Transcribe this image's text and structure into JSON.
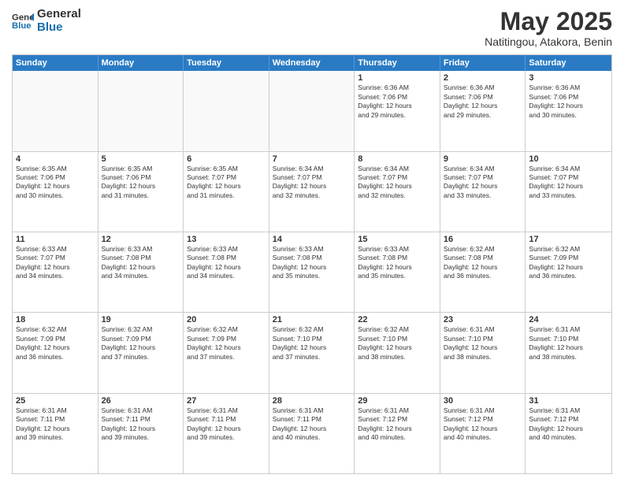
{
  "header": {
    "logo_general": "General",
    "logo_blue": "Blue",
    "title": "May 2025",
    "location": "Natitingou, Atakora, Benin"
  },
  "weekdays": [
    "Sunday",
    "Monday",
    "Tuesday",
    "Wednesday",
    "Thursday",
    "Friday",
    "Saturday"
  ],
  "rows": [
    [
      {
        "day": "",
        "info": ""
      },
      {
        "day": "",
        "info": ""
      },
      {
        "day": "",
        "info": ""
      },
      {
        "day": "",
        "info": ""
      },
      {
        "day": "1",
        "info": "Sunrise: 6:36 AM\nSunset: 7:06 PM\nDaylight: 12 hours\nand 29 minutes."
      },
      {
        "day": "2",
        "info": "Sunrise: 6:36 AM\nSunset: 7:06 PM\nDaylight: 12 hours\nand 29 minutes."
      },
      {
        "day": "3",
        "info": "Sunrise: 6:36 AM\nSunset: 7:06 PM\nDaylight: 12 hours\nand 30 minutes."
      }
    ],
    [
      {
        "day": "4",
        "info": "Sunrise: 6:35 AM\nSunset: 7:06 PM\nDaylight: 12 hours\nand 30 minutes."
      },
      {
        "day": "5",
        "info": "Sunrise: 6:35 AM\nSunset: 7:06 PM\nDaylight: 12 hours\nand 31 minutes."
      },
      {
        "day": "6",
        "info": "Sunrise: 6:35 AM\nSunset: 7:07 PM\nDaylight: 12 hours\nand 31 minutes."
      },
      {
        "day": "7",
        "info": "Sunrise: 6:34 AM\nSunset: 7:07 PM\nDaylight: 12 hours\nand 32 minutes."
      },
      {
        "day": "8",
        "info": "Sunrise: 6:34 AM\nSunset: 7:07 PM\nDaylight: 12 hours\nand 32 minutes."
      },
      {
        "day": "9",
        "info": "Sunrise: 6:34 AM\nSunset: 7:07 PM\nDaylight: 12 hours\nand 33 minutes."
      },
      {
        "day": "10",
        "info": "Sunrise: 6:34 AM\nSunset: 7:07 PM\nDaylight: 12 hours\nand 33 minutes."
      }
    ],
    [
      {
        "day": "11",
        "info": "Sunrise: 6:33 AM\nSunset: 7:07 PM\nDaylight: 12 hours\nand 34 minutes."
      },
      {
        "day": "12",
        "info": "Sunrise: 6:33 AM\nSunset: 7:08 PM\nDaylight: 12 hours\nand 34 minutes."
      },
      {
        "day": "13",
        "info": "Sunrise: 6:33 AM\nSunset: 7:08 PM\nDaylight: 12 hours\nand 34 minutes."
      },
      {
        "day": "14",
        "info": "Sunrise: 6:33 AM\nSunset: 7:08 PM\nDaylight: 12 hours\nand 35 minutes."
      },
      {
        "day": "15",
        "info": "Sunrise: 6:33 AM\nSunset: 7:08 PM\nDaylight: 12 hours\nand 35 minutes."
      },
      {
        "day": "16",
        "info": "Sunrise: 6:32 AM\nSunset: 7:08 PM\nDaylight: 12 hours\nand 36 minutes."
      },
      {
        "day": "17",
        "info": "Sunrise: 6:32 AM\nSunset: 7:09 PM\nDaylight: 12 hours\nand 36 minutes."
      }
    ],
    [
      {
        "day": "18",
        "info": "Sunrise: 6:32 AM\nSunset: 7:09 PM\nDaylight: 12 hours\nand 36 minutes."
      },
      {
        "day": "19",
        "info": "Sunrise: 6:32 AM\nSunset: 7:09 PM\nDaylight: 12 hours\nand 37 minutes."
      },
      {
        "day": "20",
        "info": "Sunrise: 6:32 AM\nSunset: 7:09 PM\nDaylight: 12 hours\nand 37 minutes."
      },
      {
        "day": "21",
        "info": "Sunrise: 6:32 AM\nSunset: 7:10 PM\nDaylight: 12 hours\nand 37 minutes."
      },
      {
        "day": "22",
        "info": "Sunrise: 6:32 AM\nSunset: 7:10 PM\nDaylight: 12 hours\nand 38 minutes."
      },
      {
        "day": "23",
        "info": "Sunrise: 6:31 AM\nSunset: 7:10 PM\nDaylight: 12 hours\nand 38 minutes."
      },
      {
        "day": "24",
        "info": "Sunrise: 6:31 AM\nSunset: 7:10 PM\nDaylight: 12 hours\nand 38 minutes."
      }
    ],
    [
      {
        "day": "25",
        "info": "Sunrise: 6:31 AM\nSunset: 7:11 PM\nDaylight: 12 hours\nand 39 minutes."
      },
      {
        "day": "26",
        "info": "Sunrise: 6:31 AM\nSunset: 7:11 PM\nDaylight: 12 hours\nand 39 minutes."
      },
      {
        "day": "27",
        "info": "Sunrise: 6:31 AM\nSunset: 7:11 PM\nDaylight: 12 hours\nand 39 minutes."
      },
      {
        "day": "28",
        "info": "Sunrise: 6:31 AM\nSunset: 7:11 PM\nDaylight: 12 hours\nand 40 minutes."
      },
      {
        "day": "29",
        "info": "Sunrise: 6:31 AM\nSunset: 7:12 PM\nDaylight: 12 hours\nand 40 minutes."
      },
      {
        "day": "30",
        "info": "Sunrise: 6:31 AM\nSunset: 7:12 PM\nDaylight: 12 hours\nand 40 minutes."
      },
      {
        "day": "31",
        "info": "Sunrise: 6:31 AM\nSunset: 7:12 PM\nDaylight: 12 hours\nand 40 minutes."
      }
    ]
  ]
}
